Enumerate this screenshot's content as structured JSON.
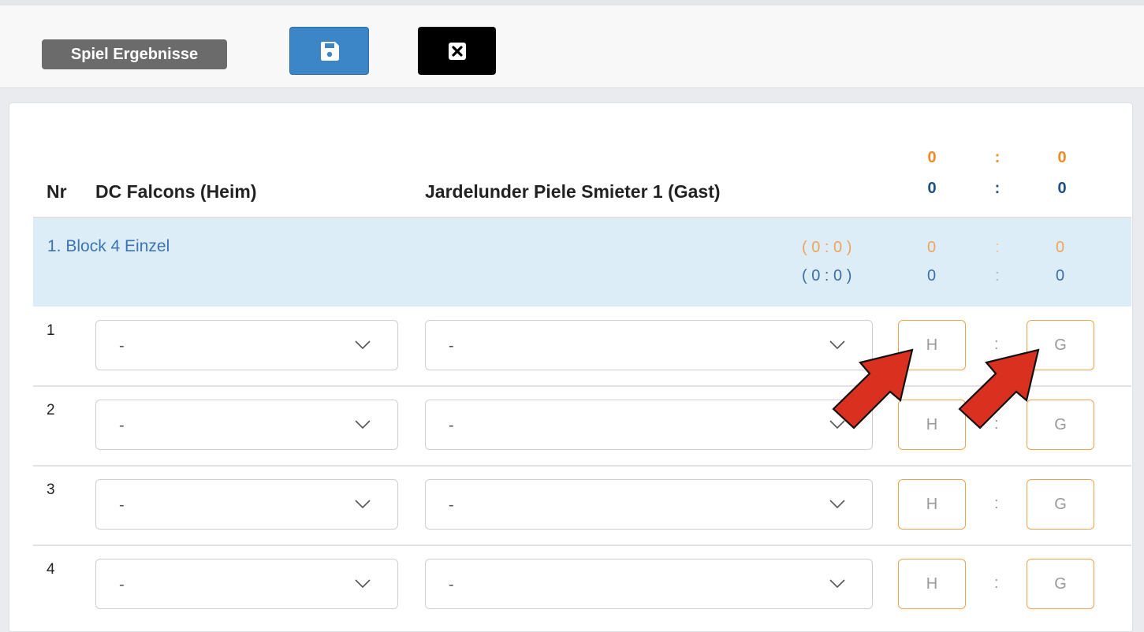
{
  "toolbar": {
    "title": "Spiel Ergebnisse",
    "save_icon": "floppy-disk-icon",
    "close_icon": "close-square-icon"
  },
  "table": {
    "col_nr": "Nr",
    "home_team": "DC Falcons (Heim)",
    "guest_team": "Jardelunder Piele Smieter 1 (Gast)",
    "totals": {
      "legs": {
        "home": "0",
        "sep": ":",
        "guest": "0"
      },
      "sets": {
        "home": "0",
        "sep": ":",
        "guest": "0"
      }
    }
  },
  "block": {
    "title": "1. Block 4 Einzel",
    "row1": {
      "paren": "( 0 : 0 )",
      "home": "0",
      "sep": ":",
      "guest": "0"
    },
    "row2": {
      "paren": "( 0 : 0 )",
      "home": "0",
      "sep": ":",
      "guest": "0"
    }
  },
  "matches": [
    {
      "nr": "1",
      "home_value": "-",
      "guest_value": "-",
      "home_placeholder": "H",
      "guest_placeholder": "G",
      "sep": ":"
    },
    {
      "nr": "2",
      "home_value": "-",
      "guest_value": "-",
      "home_placeholder": "H",
      "guest_placeholder": "G",
      "sep": ":"
    },
    {
      "nr": "3",
      "home_value": "-",
      "guest_value": "-",
      "home_placeholder": "H",
      "guest_placeholder": "G",
      "sep": ":"
    },
    {
      "nr": "4",
      "home_value": "-",
      "guest_value": "-",
      "home_placeholder": "H",
      "guest_placeholder": "G",
      "sep": ":"
    }
  ],
  "colors": {
    "accent_blue": "#3c86c8",
    "orange": "#f08a24",
    "block_bg": "#dcedf8",
    "arrow_red": "#d9301f"
  }
}
